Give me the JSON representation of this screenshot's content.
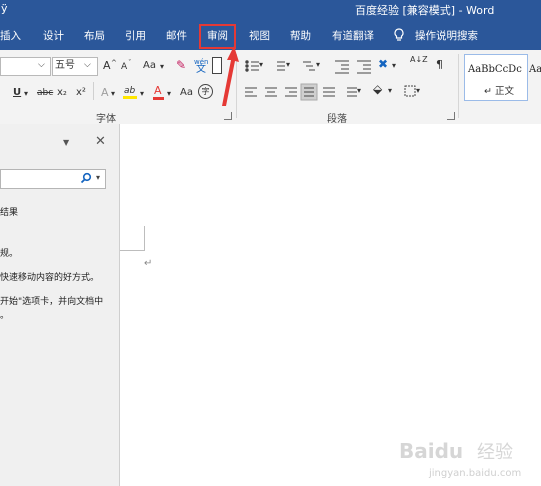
{
  "title": {
    "left_glyph": "ÿ",
    "text": "百度经验 [兼容模式] - Word"
  },
  "tabs": [
    {
      "label": "插入",
      "active": false
    },
    {
      "label": "设计",
      "active": false
    },
    {
      "label": "布局",
      "active": false
    },
    {
      "label": "引用",
      "active": false
    },
    {
      "label": "邮件",
      "active": false
    },
    {
      "label": "审阅",
      "active": true
    },
    {
      "label": "视图",
      "active": false
    },
    {
      "label": "帮助",
      "active": false
    },
    {
      "label": "有道翻译",
      "active": false
    }
  ],
  "tell_me": {
    "icon": "lightbulb-icon",
    "label": "操作说明搜索"
  },
  "ribbon": {
    "font_size_value": "五号",
    "font_group_label": "字体",
    "paragraph_group_label": "段落",
    "change_case_label": "Aa",
    "grow_font_label": "A",
    "shrink_font_label": "A",
    "phonetic_label": "wén",
    "phonetic_char": "文",
    "underline_label": "U",
    "strike_label": "abc",
    "subscript_label": "x₂",
    "superscript_label": "x²",
    "text_effects_label": "A",
    "highlight_label": "ab",
    "font_color_label": "A",
    "font_color": "#e53935",
    "highlight_color": "#ffe600",
    "aa_label": "Aa",
    "enclose_char_label": "字",
    "sort_label": "A↓Z"
  },
  "styles": {
    "normal_sample": "AaBbCcDc",
    "normal_name": "↵ 正文",
    "next_sample": "Aa"
  },
  "nav_pane": {
    "search_icon": "magnifier-icon",
    "lines": [
      "结果",
      "规。",
      "快速移动内容的好方式。",
      "开始\"选项卡，并向文档中",
      "。"
    ]
  },
  "document": {
    "paragraph_mark": "↵"
  },
  "annotations": {
    "highlight_color": "#e53935"
  },
  "watermark": {
    "brand": "Baidu",
    "brand_cn": "经验",
    "url": "jingyan.baidu.com"
  }
}
